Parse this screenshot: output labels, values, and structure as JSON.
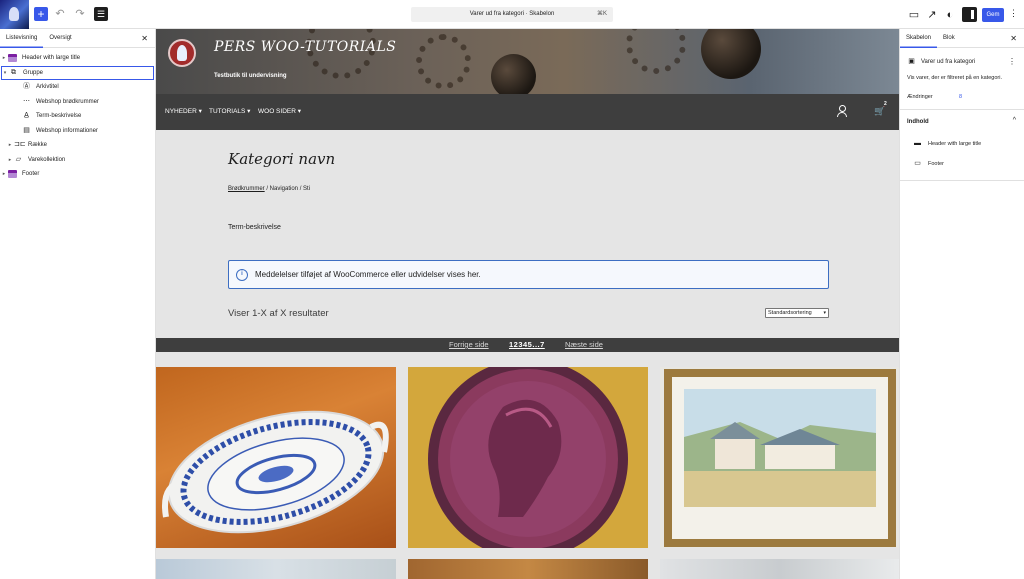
{
  "topbar": {
    "command_title": "Varer ud fra kategori · Skabelon",
    "command_shortcut": "⌘K",
    "save_label": "Gem",
    "more": "⋮"
  },
  "left_panel": {
    "tabs": [
      {
        "label": "Listevisning"
      },
      {
        "label": "Oversigt"
      }
    ],
    "close": "✕",
    "tree": [
      {
        "label": "Header with large title"
      },
      {
        "label": "Gruppe"
      },
      {
        "label": "Arkivtitel"
      },
      {
        "label": "Webshop brødkrummer"
      },
      {
        "label": "Term-beskrivelse"
      },
      {
        "label": "Webshop informationer"
      },
      {
        "label": "Række"
      },
      {
        "label": "Varekollektion"
      },
      {
        "label": "Footer"
      }
    ]
  },
  "site": {
    "title": "PERS WOO-TUTORIALS",
    "tagline": "Testbutik til undervisning",
    "nav": [
      {
        "label": "NYHEDER ▾"
      },
      {
        "label": "TUTORIALS ▾"
      },
      {
        "label": "WOO SIDER ▾"
      }
    ],
    "cart_icon": "🛒",
    "cart_count": "2"
  },
  "content": {
    "category_title": "Kategori navn",
    "breadcrumb_link": "Brødkrummer",
    "breadcrumb_rest": " / Navigation / Sti",
    "term_description": "Term-beskrivelse",
    "notice_icon": "i",
    "notice": "Meddelelser tilføjet af WooCommerce eller udvidelser vises her.",
    "result_count": "Viser 1-X af X resultater",
    "sort_default": "Standardsortering",
    "pagination": {
      "prev": "Forrige side",
      "pages": "12345...7",
      "next": "Næste side"
    }
  },
  "right_panel": {
    "tabs": [
      {
        "label": "Skabelon"
      },
      {
        "label": "Blok"
      }
    ],
    "close": "✕",
    "template_name": "Varer ud fra kategori",
    "more": "⋮",
    "description": "Vis varer, der er filtreret på en kategori.",
    "changes_label": "Ændringer",
    "changes_value": "8",
    "section_title": "Indhold",
    "chevron": "^",
    "items": [
      {
        "label": "Header with large title"
      },
      {
        "label": "Footer"
      }
    ]
  }
}
